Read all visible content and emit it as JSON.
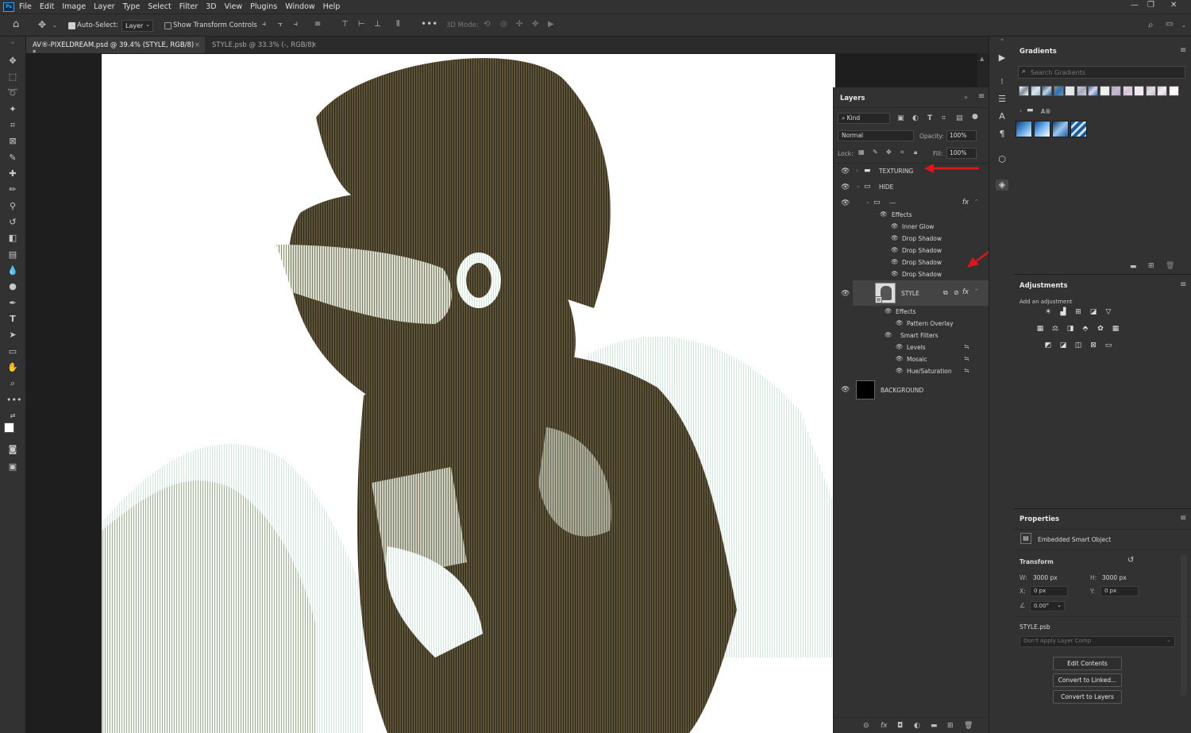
{
  "app": {
    "logo": "Ps"
  },
  "menu": [
    "File",
    "Edit",
    "Image",
    "Layer",
    "Type",
    "Select",
    "Filter",
    "3D",
    "View",
    "Plugins",
    "Window",
    "Help"
  ],
  "options": {
    "auto_select_label": "Auto-Select:",
    "auto_select_value": "Layer",
    "show_transform_label": "Show Transform Controls",
    "mode_3d_label": "3D Mode:"
  },
  "tabs": [
    {
      "label": "AV®-PIXELDREAM.psd @ 39.4% (STYLE, RGB/8) *",
      "active": true
    },
    {
      "label": "STYLE.psb @ 33.3% (-, RGB/8)",
      "active": false
    }
  ],
  "layers_panel": {
    "title": "Layers",
    "filter_kind": "Kind",
    "blend_mode": "Normal",
    "opacity_label": "Opacity:",
    "opacity": "100%",
    "lock_label": "Lock:",
    "fill_label": "Fill:",
    "fill": "100%",
    "rows": [
      {
        "name": "TEXTURING",
        "type": "group"
      },
      {
        "name": "HIDE",
        "type": "group"
      },
      {
        "name": "---",
        "type": "group",
        "fx": "fx"
      },
      {
        "name": "Effects",
        "type": "effects"
      },
      {
        "name": "Inner Glow",
        "type": "effect"
      },
      {
        "name": "Drop Shadow",
        "type": "effect"
      },
      {
        "name": "Drop Shadow",
        "type": "effect"
      },
      {
        "name": "Drop Shadow",
        "type": "effect"
      },
      {
        "name": "Drop Shadow",
        "type": "effect"
      },
      {
        "name": "STYLE",
        "type": "smart",
        "fx": "fx"
      },
      {
        "name": "Effects",
        "type": "effects"
      },
      {
        "name": "Pattern Overlay",
        "type": "effect"
      },
      {
        "name": "Smart Filters",
        "type": "filters"
      },
      {
        "name": "Levels",
        "type": "filter"
      },
      {
        "name": "Mosaic",
        "type": "filter"
      },
      {
        "name": "Hue/Saturation",
        "type": "filter"
      },
      {
        "name": "BACKGROUND",
        "type": "layer"
      }
    ]
  },
  "gradients_panel": {
    "title": "Gradients",
    "search_placeholder": "Search Gradients",
    "folder": "A®",
    "colors": [
      "#ffffff",
      "#9fb4c8",
      "#1e5fa0",
      "#7f8c99",
      "#d9e4ee",
      "#c6d1da",
      "#2d74b8",
      "#e8e8e8",
      "#a9a9c2",
      "#e0d8e8",
      "#f2f2f2",
      "#cdb7d0",
      "#d6c6d6",
      "#f4e4ef",
      "#dfdfdf",
      "#f0f0f0"
    ]
  },
  "adjustments_panel": {
    "title": "Adjustments",
    "subtitle": "Add an adjustment"
  },
  "properties_panel": {
    "title": "Properties",
    "type": "Embedded Smart Object",
    "transform_label": "Transform",
    "w_label": "W:",
    "w": "3000 px",
    "h_label": "H:",
    "h": "3000 px",
    "x_label": "X:",
    "x": "0 px",
    "y_label": "Y:",
    "y": "0 px",
    "angle": "0.00°",
    "file": "STYLE.psb",
    "layer_comp": "Don't Apply Layer Comp",
    "btn_edit": "Edit Contents",
    "btn_linked": "Convert to Linked...",
    "btn_layers": "Convert to Layers"
  },
  "accent": {
    "arrow": "#e0141a",
    "photo_tint": "#5d5136",
    "photo_highlight": "#e6f4ec"
  }
}
